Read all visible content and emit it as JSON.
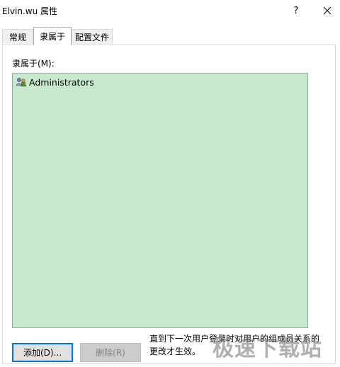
{
  "window": {
    "title": "Elvin.wu 属性",
    "help_label": "?",
    "close_icon": "close-icon"
  },
  "tabs": [
    {
      "label": "常规",
      "active": false
    },
    {
      "label": "隶属于",
      "active": true
    },
    {
      "label": "配置文件",
      "active": false
    }
  ],
  "member_of": {
    "label": "隶属于(M):",
    "items": [
      {
        "name": "Administrators",
        "icon": "user-group-icon"
      }
    ],
    "list_color": "#c9e9cf"
  },
  "buttons": {
    "add": "添加(D)...",
    "remove": "删除(R)"
  },
  "note": "直到下一次用户登录时对用户的组成员关系的更改才生效。",
  "watermark": "极速下载站"
}
